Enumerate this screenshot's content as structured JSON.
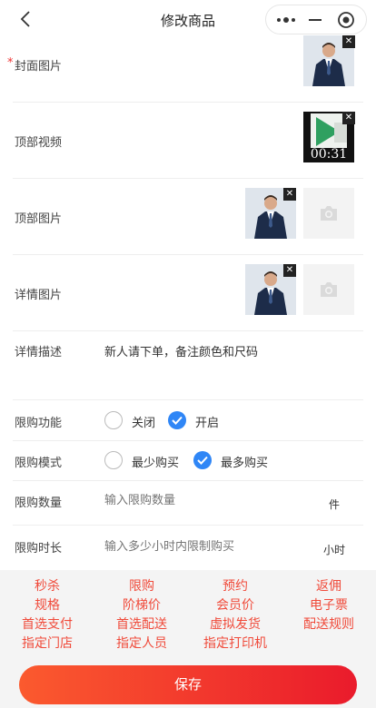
{
  "nav": {
    "title": "修改商品",
    "back_icon": "chevron-left-icon",
    "more_icon": "more-dots-icon",
    "minimize_icon": "minus-icon",
    "close_icon": "target-circle-icon"
  },
  "form": {
    "cover": {
      "label": "封面图片",
      "required_mark": "*"
    },
    "top_video": {
      "label": "顶部视频",
      "duration": "00:31"
    },
    "top_image": {
      "label": "顶部图片"
    },
    "detail_image": {
      "label": "详情图片"
    },
    "detail_desc": {
      "label": "详情描述",
      "value": "新人请下单，备注颜色和尺码"
    },
    "limit_function": {
      "label": "限购功能",
      "options": [
        "关闭",
        "开启"
      ],
      "selected": "开启"
    },
    "limit_mode": {
      "label": "限购模式",
      "options": [
        "最少购买",
        "最多购买"
      ],
      "selected": "最多购买"
    },
    "limit_quantity": {
      "label": "限购数量",
      "placeholder": "输入限购数量",
      "unit": "件"
    },
    "limit_duration": {
      "label": "限购时长",
      "placeholder": "输入多少小时内限制购买",
      "unit": "小时"
    }
  },
  "feature_links": [
    [
      "秒杀",
      "限购",
      "预约",
      "返佣"
    ],
    [
      "规格",
      "阶梯价",
      "会员价",
      "电子票"
    ],
    [
      "首选支付",
      "首选配送",
      "虚拟发货",
      "配送规则"
    ],
    [
      "指定门店",
      "指定人员",
      "指定打印机"
    ]
  ],
  "save_button": "保存",
  "colors": {
    "accent_blue": "#2f86f6",
    "link_red": "#f04a3a",
    "save_start": "#fb5a2e",
    "save_end": "#ea1b2c"
  }
}
